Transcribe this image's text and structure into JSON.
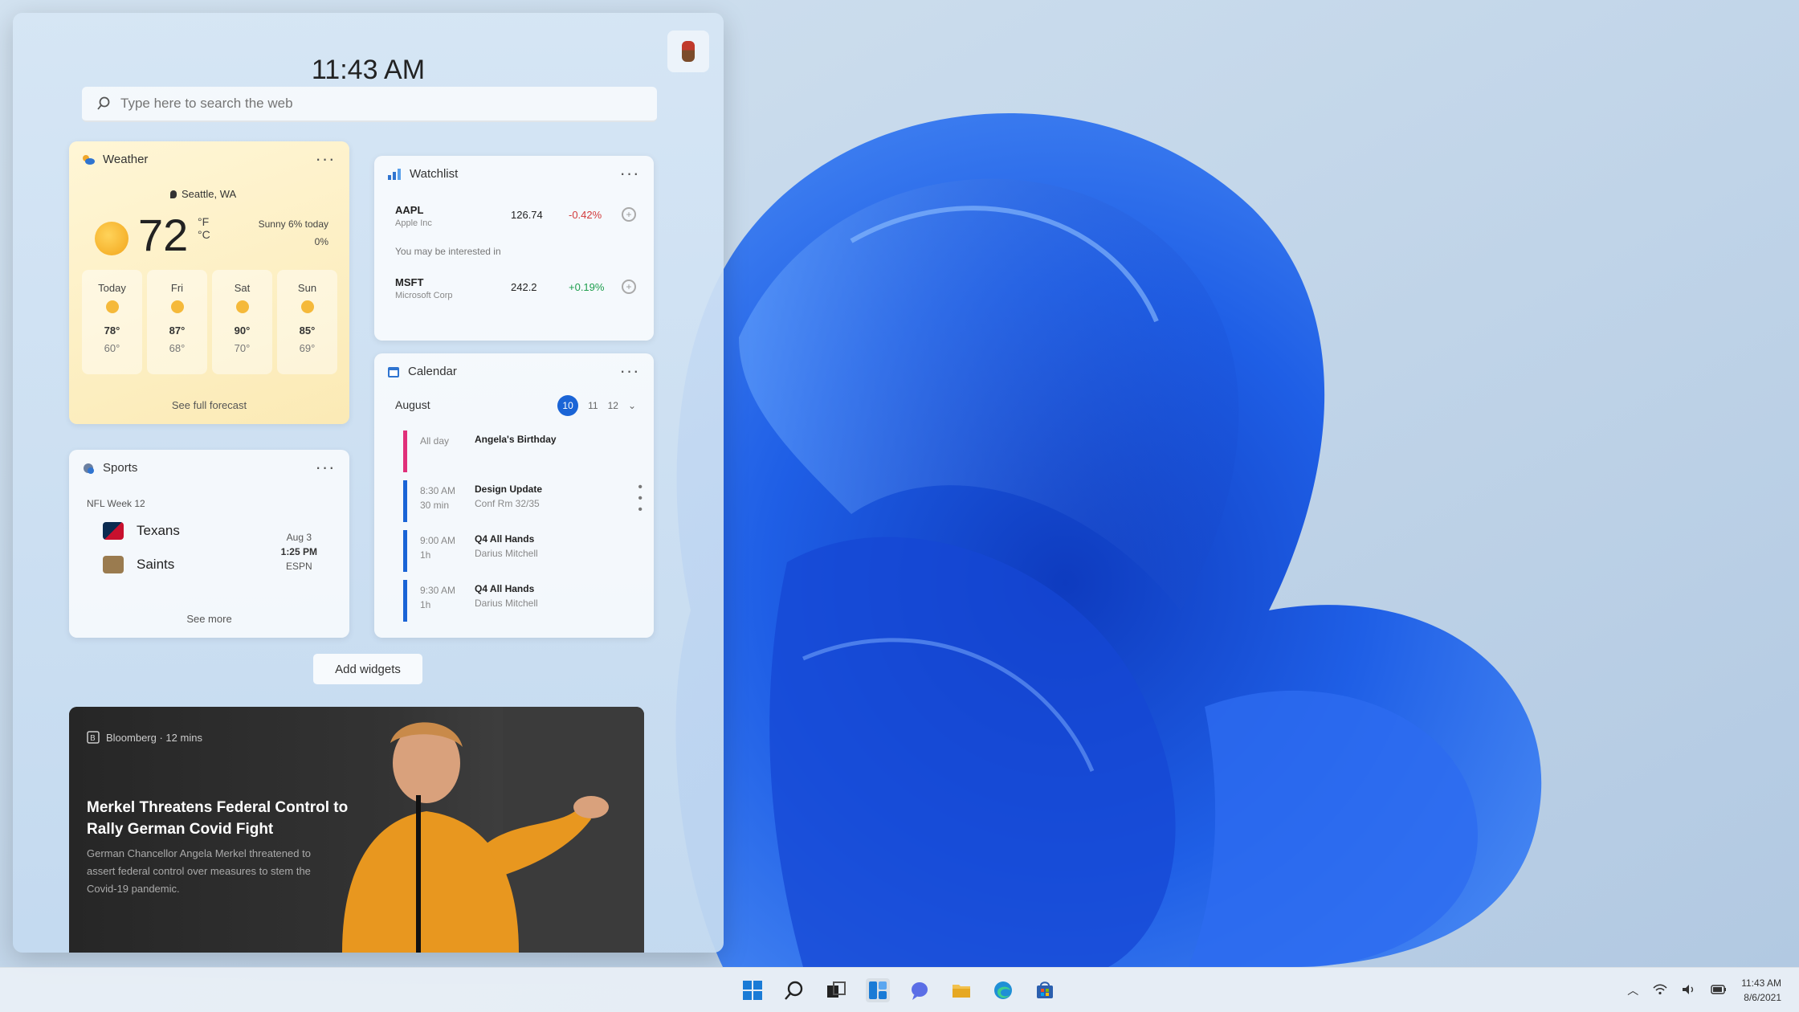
{
  "panel": {
    "time": "11:43 AM",
    "search_placeholder": "Type here to search the web",
    "add_widgets_label": "Add widgets"
  },
  "weather": {
    "title": "Weather",
    "location": "Seattle, WA",
    "temp": "72",
    "unit_f": "°F",
    "unit_c": "°C",
    "desc_line1": "Sunny 6% today",
    "desc_line2": "0%",
    "forecast": [
      {
        "day": "Today",
        "hi": "78°",
        "lo": "60°"
      },
      {
        "day": "Fri",
        "hi": "87°",
        "lo": "68°"
      },
      {
        "day": "Sat",
        "hi": "90°",
        "lo": "70°"
      },
      {
        "day": "Sun",
        "hi": "85°",
        "lo": "69°"
      }
    ],
    "link": "See full forecast"
  },
  "watchlist": {
    "title": "Watchlist",
    "hint": "You may be interested in",
    "stocks": [
      {
        "symbol": "AAPL",
        "name": "Apple Inc",
        "price": "126.74",
        "change": "-0.42%"
      },
      {
        "symbol": "MSFT",
        "name": "Microsoft Corp",
        "price": "242.2",
        "change": "+0.19%"
      }
    ]
  },
  "calendar": {
    "title": "Calendar",
    "month": "August",
    "days": [
      "10",
      "11",
      "12"
    ],
    "events": [
      {
        "time": "All day",
        "duration": "",
        "title": "Angela's Birthday",
        "sub": ""
      },
      {
        "time": "8:30 AM",
        "duration": "30 min",
        "title": "Design Update",
        "sub": "Conf Rm 32/35"
      },
      {
        "time": "9:00 AM",
        "duration": "1h",
        "title": "Q4 All Hands",
        "sub": "Darius Mitchell"
      },
      {
        "time": "9:30 AM",
        "duration": "1h",
        "title": "Q4 All Hands",
        "sub": "Darius Mitchell"
      }
    ]
  },
  "sports": {
    "title": "Sports",
    "game": "NFL Week 12",
    "team1": "Texans",
    "team2": "Saints",
    "date": "Aug 3",
    "time": "1:25 PM",
    "channel": "ESPN",
    "link": "See more"
  },
  "news": {
    "source": "Bloomberg · 12 mins",
    "title": "Merkel Threatens Federal Control to Rally German Covid Fight",
    "body": "German Chancellor Angela Merkel threatened to assert federal control over measures to stem the Covid-19 pandemic."
  },
  "tray": {
    "time": "11:43 AM",
    "date": "8/6/2021"
  },
  "colors": {
    "accent": "#1a64d6",
    "wallpaper_bloom": "#1f5fe6"
  }
}
